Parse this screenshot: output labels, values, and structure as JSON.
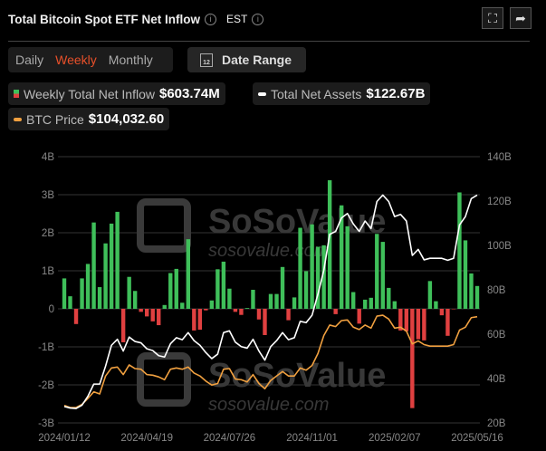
{
  "header": {
    "title": "Total Bitcoin Spot ETF Net Inflow",
    "timezone": "EST",
    "info_icon": "i"
  },
  "controls": {
    "periods": [
      "Daily",
      "Weekly",
      "Monthly"
    ],
    "selected": "Weekly",
    "date_range_label": "Date Range",
    "calendar_day": "12"
  },
  "legend": {
    "inflow": {
      "label": "Weekly Total Net Inflow",
      "value": "$603.74M"
    },
    "assets": {
      "label": "Total Net Assets",
      "value": "$122.67B"
    },
    "btc": {
      "label": "BTC Price",
      "value": "$104,032.60"
    }
  },
  "colors": {
    "positive": "#3fbf5a",
    "negative": "#e04040",
    "assets": "#ffffff",
    "btc": "#f0a040",
    "active": "#e8502a"
  },
  "watermark": {
    "brand": "SoSoValue",
    "url": "sosovalue.com"
  },
  "chart_data": {
    "type": "bar",
    "title": "Total Bitcoin Spot ETF Net Inflow",
    "x_tick_labels": [
      "2024/01/12",
      "2024/04/19",
      "2024/07/26",
      "2024/11/01",
      "2025/02/07",
      "2025/05/16"
    ],
    "left_axis": {
      "ticks": [
        "4B",
        "3B",
        "2B",
        "1B",
        "0",
        "-1B",
        "-2B",
        "-3B"
      ],
      "range": [
        -3,
        4
      ],
      "unit": "B USD"
    },
    "right_axis": {
      "ticks": [
        "140B",
        "120B",
        "100B",
        "80B",
        "60B",
        "40B",
        "20B"
      ],
      "range": [
        20,
        140
      ],
      "unit": "B USD"
    },
    "btc_axis_hidden_range": [
      35000,
      208000
    ],
    "grid": true,
    "series": [
      {
        "name": "Weekly Total Net Inflow",
        "type": "bar",
        "unit": "B",
        "values": [
          0.8,
          0.33,
          -0.4,
          0.8,
          1.18,
          2.27,
          0.57,
          1.72,
          2.24,
          2.55,
          -0.88,
          0.84,
          0.47,
          -0.08,
          -0.2,
          -0.33,
          -0.43,
          0.1,
          0.94,
          1.05,
          0.16,
          1.83,
          -0.57,
          -0.55,
          -0.04,
          0.22,
          1.04,
          1.24,
          0.53,
          -0.08,
          -0.16,
          0.02,
          0.5,
          -0.28,
          -0.69,
          0.39,
          0.39,
          1.1,
          -0.3,
          0.3,
          2.13,
          0.99,
          2.22,
          1.63,
          1.67,
          3.38,
          -0.14,
          2.72,
          2.17,
          0.44,
          -0.39,
          0.24,
          0.29,
          1.97,
          1.76,
          0.55,
          0.2,
          -0.57,
          -0.59,
          -2.61,
          -0.8,
          -0.83,
          0.73,
          0.2,
          -0.17,
          -0.71,
          -0.01,
          3.06,
          1.8,
          0.93,
          0.6
        ]
      },
      {
        "name": "Total Net Assets",
        "type": "line",
        "unit": "B",
        "values": [
          27.4,
          26.7,
          26.5,
          28,
          32,
          37.5,
          37.5,
          45.6,
          55,
          57.7,
          52.4,
          58.7,
          56.7,
          56.1,
          53.4,
          52.6,
          50.3,
          49.7,
          55.7,
          58.4,
          57.5,
          60.7,
          57.1,
          55,
          51.7,
          49,
          51,
          60.7,
          61.5,
          56.4,
          54.4,
          53.7,
          57.7,
          52.4,
          48.3,
          54.4,
          57.1,
          60.7,
          57.5,
          58.4,
          65.8,
          65.2,
          68.5,
          78,
          88.8,
          105,
          106.3,
          112.4,
          114.4,
          109.7,
          106.3,
          111,
          107.6,
          119.8,
          122.7,
          119.8,
          113,
          114,
          111,
          95.5,
          98.2,
          93.5,
          94.2,
          94.2,
          94.2,
          93.3,
          94.2,
          109.2,
          113,
          121.1,
          122.67
        ]
      },
      {
        "name": "BTC Price",
        "type": "line",
        "unit": "kUSD",
        "values": [
          46.4,
          45.0,
          45.0,
          47.0,
          50.9,
          55.2,
          53.8,
          65.5,
          70.7,
          71.3,
          66.4,
          72.7,
          70.3,
          69.9,
          66.4,
          66.0,
          64.9,
          63.1,
          69.9,
          70.7,
          69.9,
          71.3,
          67.4,
          65.5,
          62.2,
          59.6,
          60.6,
          69.9,
          70.3,
          63.5,
          63.1,
          61.6,
          66.4,
          60.6,
          57.2,
          62.6,
          65.5,
          68.4,
          65.5,
          65.5,
          70.7,
          69.3,
          72.3,
          80.1,
          91.8,
          98.6,
          97.6,
          101.5,
          101.9,
          97.2,
          95.7,
          98.6,
          96.6,
          104.4,
          105.0,
          102.5,
          96.6,
          97.2,
          94.7,
          86.3,
          88.3,
          85.9,
          84.9,
          84.9,
          84.9,
          84.9,
          85.9,
          95.3,
          97.2,
          103.4,
          104.03
        ]
      }
    ]
  }
}
